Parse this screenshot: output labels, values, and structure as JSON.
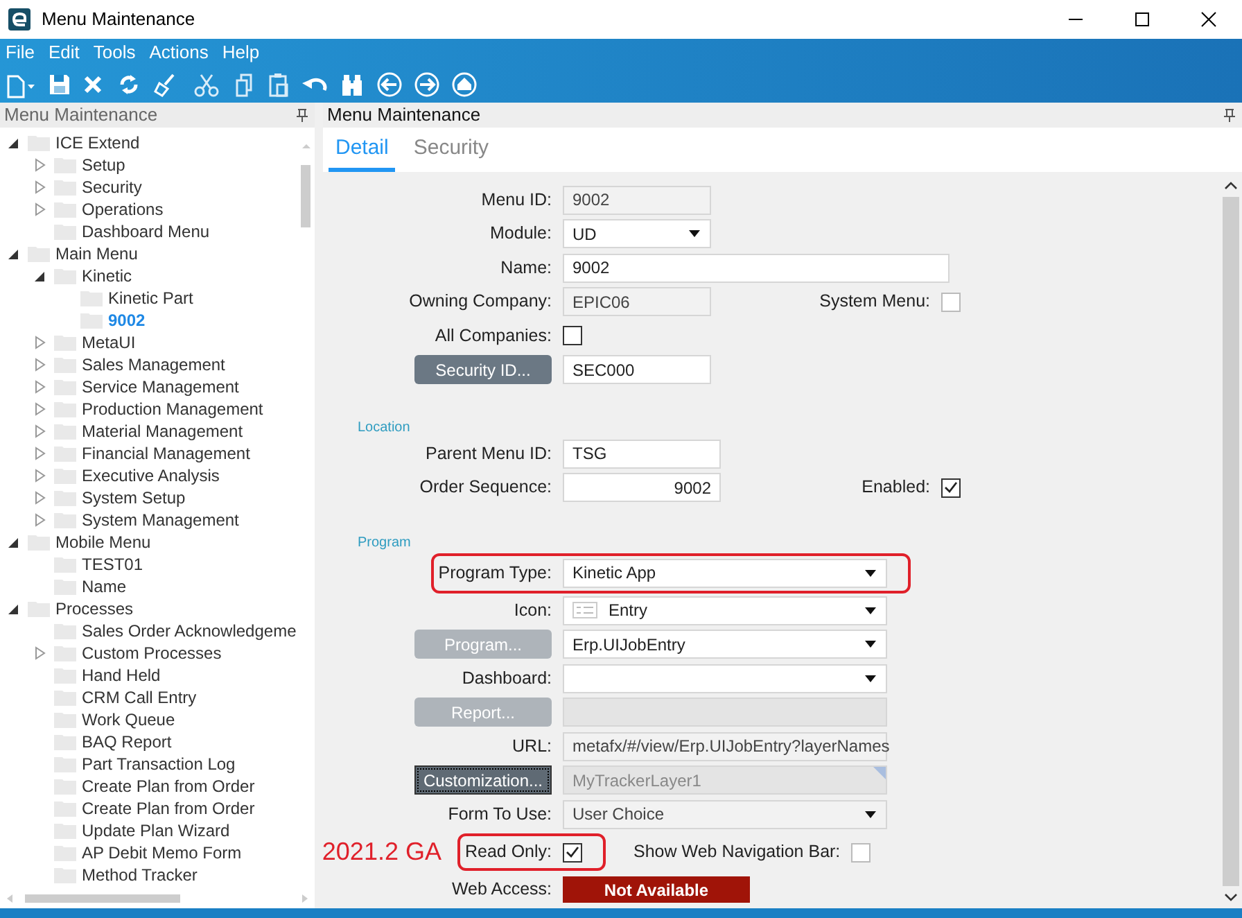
{
  "window": {
    "title": "Menu Maintenance"
  },
  "menu": [
    "File",
    "Edit",
    "Tools",
    "Actions",
    "Help"
  ],
  "left_panel": {
    "title": "Menu Maintenance",
    "tree": [
      {
        "label": "ICE Extend",
        "expanded": true,
        "selected": false,
        "children": [
          {
            "label": "Setup",
            "expanded": false,
            "selected": false
          },
          {
            "label": "Security",
            "expanded": false,
            "selected": false
          },
          {
            "label": "Operations",
            "expanded": false,
            "selected": false
          },
          {
            "label": "Dashboard Menu",
            "selected": false
          }
        ]
      },
      {
        "label": "Main Menu",
        "expanded": true,
        "selected": false,
        "children": [
          {
            "label": "Kinetic",
            "expanded": true,
            "selected": false,
            "children": [
              {
                "label": "Kinetic Part",
                "selected": false
              },
              {
                "label": "9002",
                "selected": true
              }
            ]
          },
          {
            "label": "MetaUI",
            "expanded": false,
            "selected": false
          },
          {
            "label": "Sales Management",
            "expanded": false,
            "selected": false
          },
          {
            "label": "Service Management",
            "expanded": false,
            "selected": false
          },
          {
            "label": "Production Management",
            "expanded": false,
            "selected": false
          },
          {
            "label": "Material Management",
            "expanded": false,
            "selected": false
          },
          {
            "label": "Financial Management",
            "expanded": false,
            "selected": false
          },
          {
            "label": "Executive Analysis",
            "expanded": false,
            "selected": false
          },
          {
            "label": "System Setup",
            "expanded": false,
            "selected": false
          },
          {
            "label": "System Management",
            "expanded": false,
            "selected": false
          }
        ]
      },
      {
        "label": "Mobile Menu",
        "expanded": true,
        "selected": false,
        "children": [
          {
            "label": "TEST01",
            "selected": false
          },
          {
            "label": "Name",
            "selected": false
          }
        ]
      },
      {
        "label": "Processes",
        "expanded": true,
        "selected": false,
        "children": [
          {
            "label": "Sales Order Acknowledgeme",
            "selected": false
          },
          {
            "label": "Custom Processes",
            "expanded": false,
            "selected": false
          },
          {
            "label": "Hand Held",
            "selected": false
          },
          {
            "label": "CRM Call Entry",
            "selected": false
          },
          {
            "label": "Work Queue",
            "selected": false
          },
          {
            "label": "BAQ Report",
            "selected": false
          },
          {
            "label": "Part Transaction Log",
            "selected": false
          },
          {
            "label": "Create Plan from Order",
            "selected": false
          },
          {
            "label": "Create Plan from Order",
            "selected": false
          },
          {
            "label": "Update Plan Wizard",
            "selected": false
          },
          {
            "label": "AP Debit Memo Form",
            "selected": false
          },
          {
            "label": "Method Tracker",
            "selected": false
          }
        ]
      }
    ]
  },
  "right_panel": {
    "title": "Menu Maintenance",
    "tabs": [
      {
        "label": "Detail",
        "selected": true
      },
      {
        "label": "Security",
        "selected": false
      }
    ],
    "sections": [
      {
        "fields": [
          {
            "kind": "text",
            "label": "Menu ID:",
            "value": "9002",
            "readonly": true
          },
          {
            "kind": "combo",
            "label": "Module:",
            "value": "UD"
          },
          {
            "kind": "text",
            "label": "Name:",
            "value": "9002"
          },
          {
            "kind": "text",
            "label": "Owning Company:",
            "value": "EPIC06",
            "readonly": true,
            "aside": {
              "label": "System Menu:",
              "checked": false,
              "disabled": true
            }
          },
          {
            "kind": "checkbox",
            "label": "All Companies:",
            "checked": false
          },
          {
            "kind": "text",
            "button": {
              "label": "Security ID...",
              "disabled": false
            },
            "value": "SEC000"
          }
        ]
      },
      {
        "title": "Location",
        "fields": [
          {
            "kind": "text",
            "label": "Parent Menu ID:",
            "value": "TSG"
          },
          {
            "kind": "number",
            "label": "Order Sequence:",
            "value": "9002",
            "aside": {
              "label": "Enabled:",
              "checked": true,
              "disabled": false
            }
          }
        ]
      },
      {
        "title": "Program",
        "fields": [
          {
            "kind": "combo",
            "label": "Program Type:",
            "value": "Kinetic App",
            "highlighted": true
          },
          {
            "kind": "icon-combo",
            "label": "Icon:",
            "value": "Entry"
          },
          {
            "kind": "combo",
            "button": {
              "label": "Program...",
              "disabled": true
            },
            "value": "Erp.UIJobEntry"
          },
          {
            "kind": "combo",
            "label": "Dashboard:"
          },
          {
            "kind": "text",
            "button": {
              "label": "Report...",
              "disabled": true
            },
            "readonly": true
          },
          {
            "kind": "text",
            "label": "URL:",
            "value": "metafx/#/view/Erp.UIJobEntry?layerNames",
            "readonly": true
          },
          {
            "kind": "text",
            "button": {
              "label": "Customization...",
              "disabled": false,
              "focused": true
            },
            "value": "MyTrackerLayer1",
            "readonly": true,
            "corner_flag": true
          },
          {
            "kind": "combo",
            "label": "Form To Use:",
            "value": "User Choice",
            "readonly": true
          },
          {
            "kind": "checkbox",
            "label": "Read Only:",
            "checked": true,
            "highlighted": true,
            "annotation": "2021.2 GA",
            "aside": {
              "label": "Show Web Navigation Bar:",
              "checked": false,
              "disabled": true
            }
          },
          {
            "kind": "status",
            "label": "Web Access:",
            "value": "Not Available"
          }
        ]
      }
    ]
  }
}
